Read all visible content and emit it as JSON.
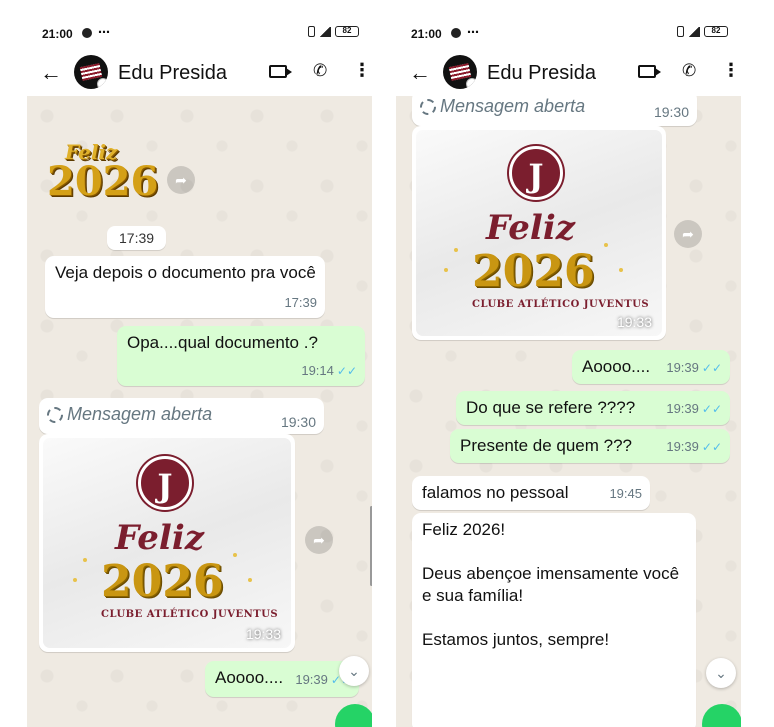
{
  "status": {
    "time": "21:00",
    "battery": "82"
  },
  "header": {
    "contact_name": "Edu Presida"
  },
  "left": {
    "sticker_feliz": "Feliz",
    "sticker_year": "2026",
    "stamp1": "17:39",
    "msg1_text": "Veja depois o documento pra você",
    "msg1_time": "17:39",
    "msg2_text": "Opa....qual documento .?",
    "msg2_time": "19:14",
    "viewonce_label": "Mensagem aberta",
    "viewonce_time": "19:30",
    "image_time": "19:33",
    "msg3_text": "Aoooo....",
    "msg3_time": "19:39"
  },
  "right": {
    "viewonce_label": "Mensagem aberta",
    "viewonce_time": "19:30",
    "image_time": "19:33",
    "out1_text": "Aoooo....",
    "out1_time": "19:39",
    "out2_text": "Do que se refere ????",
    "out2_time": "19:39",
    "out3_text": "Presente de quem ???",
    "out3_time": "19:39",
    "in1_text": "falamos no pessoal",
    "in1_time": "19:45",
    "in2_line1": "Feliz 2026!",
    "in2_line2": "Deus abençoe imensamente você e sua família!",
    "in2_line3": "Estamos juntos, sempre!"
  },
  "image_card": {
    "logo_letter": "J",
    "feliz": "Feliz",
    "year": "2026",
    "club": "CLUBE ATLÉTICO JUVENTUS"
  },
  "icons": [
    "back-arrow-icon",
    "video-call-icon",
    "voice-call-icon",
    "menu-icon",
    "forward-icon",
    "scroll-down-icon",
    "view-once-icon"
  ],
  "colors": {
    "outgoing": "#d9fdd3",
    "incoming": "#ffffff",
    "chat_bg": "#efeae2",
    "ticks": "#53bdeb",
    "club_maroon": "#7b1e2e"
  }
}
